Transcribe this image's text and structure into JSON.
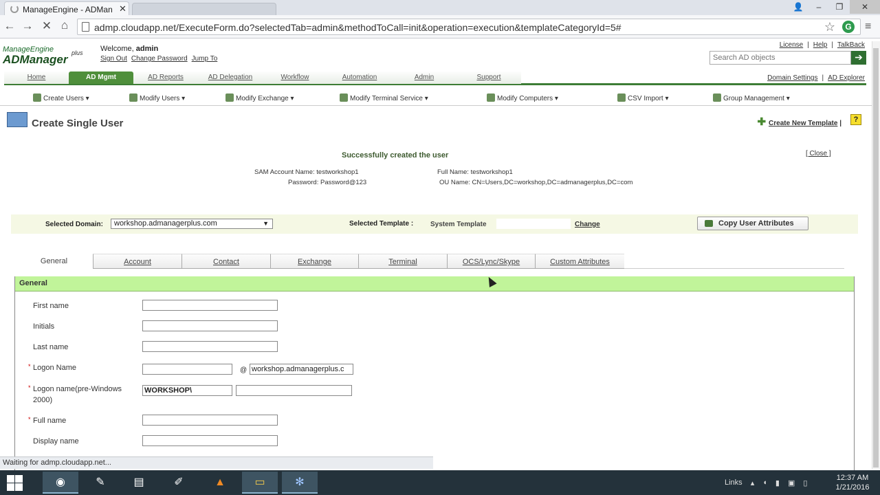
{
  "browser": {
    "tab_title": "ManageEngine - ADMana",
    "tab2_title": "",
    "url": "admp.cloudapp.net/ExecuteForm.do?selectedTab=admin&methodToCall=init&operation=execution&templateCategoryId=5#",
    "back_icon": "arrow-left",
    "forward_icon": "arrow-right",
    "stop_icon": "x",
    "home_icon": "home",
    "star_icon": "star",
    "extension_label": "G",
    "menu_icon": "hamburger",
    "status_text": "Waiting for admp.cloudapp.net..."
  },
  "app": {
    "logo_top": "ManageEngine",
    "logo_main": "ADManager",
    "logo_plus": "plus",
    "welcome_label": "Welcome,",
    "username": "admin",
    "sign_out": "Sign Out",
    "change_password": "Change Password",
    "jump_to": "Jump To",
    "top_links": [
      "License",
      "Help",
      "TalkBack"
    ],
    "search_placeholder": "Search AD objects",
    "domain_settings": "Domain Settings",
    "ad_explorer": "AD Explorer",
    "main_nav": [
      "Home",
      "AD Mgmt",
      "AD Reports",
      "AD Delegation",
      "Workflow",
      "Automation",
      "Admin",
      "Support"
    ],
    "active_nav": "AD Mgmt",
    "sub_nav": [
      "Create Users",
      "Modify Users",
      "Modify Exchange",
      "Modify Terminal Service",
      "Modify Computers",
      "CSV Import",
      "Group Management"
    ]
  },
  "page": {
    "title": "Create Single User",
    "create_template": "Create New Template",
    "help": "?",
    "success_message": "Successfully created the user",
    "close": "[ Close ]",
    "sam_label": "SAM Account Name:",
    "sam_value": "testworkshop1",
    "password_label": "Password:",
    "password_value": "Password@123",
    "fullname_label": "Full Name:",
    "fullname_value": "testworkshop1",
    "ou_label": "OU Name:",
    "ou_value": "CN=Users,DC=workshop,DC=admanagerplus,DC=com",
    "selected_domain_label": "Selected Domain:",
    "selected_domain": "workshop.admanagerplus.com",
    "selected_template_label": "Selected Template :",
    "selected_template": "System Template",
    "change": "Change",
    "copy_attributes": "Copy User Attributes"
  },
  "tabs": [
    "General",
    "Account",
    "Contact",
    "Exchange",
    "Terminal",
    "OCS/Lync/Skype",
    "Custom Attributes"
  ],
  "active_tab": "General",
  "form": {
    "section_title": "General",
    "fields": [
      {
        "label": "First name",
        "value": ""
      },
      {
        "label": "Initials",
        "value": ""
      },
      {
        "label": "Last name",
        "value": ""
      },
      {
        "label": "Logon Name",
        "value": "",
        "required": "*"
      },
      {
        "label": "Logon name(pre-Windows 2000)",
        "value": "",
        "required": "*"
      },
      {
        "label": "Full name",
        "value": "",
        "required": "*"
      },
      {
        "label": "Display name",
        "value": ""
      }
    ],
    "at_sign": "@",
    "logon_domain": "workshop.admanagerplus.c",
    "prewin_domain": "WORKSHOP\\"
  },
  "taskbar": {
    "tray_label": "Links",
    "time": "12:37 AM",
    "date": "1/21/2016"
  }
}
